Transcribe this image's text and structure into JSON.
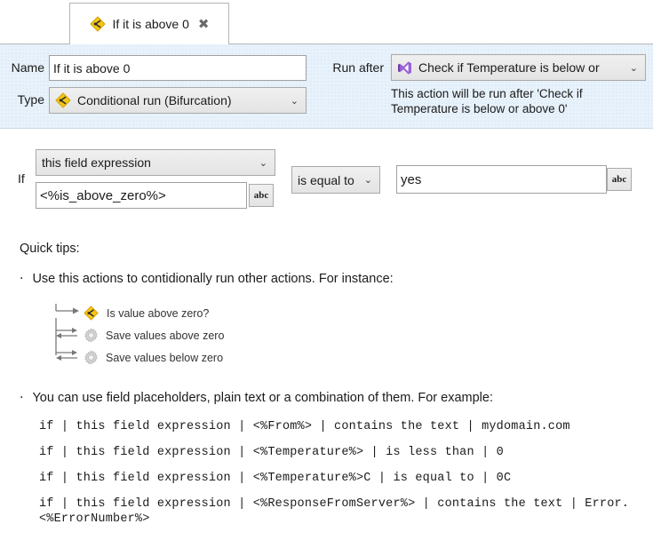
{
  "tab": {
    "label": "If it is above 0",
    "icon": "bifurcation-diamond-icon",
    "close_glyph": "✖"
  },
  "header": {
    "name_label": "Name",
    "name_value": "If it is above 0",
    "type_label": "Type",
    "type_value": "Conditional run (Bifurcation)",
    "type_icon": "bifurcation-diamond-icon",
    "run_after_label": "Run after",
    "run_after_value": "Check if Temperature is below or",
    "run_after_icon": "visual-studio-icon",
    "run_after_help": "This action will be run after 'Check if Temperature is below or above 0'",
    "chevron": "⌄",
    "panel_bg": "#e8f2fb"
  },
  "condition": {
    "if_label": "If",
    "field_selector": "this field expression",
    "expression_value": "<%is_above_zero%>",
    "expression_abc_label": "abc",
    "operator": "is equal to",
    "value": "yes",
    "value_abc_label": "abc",
    "chevron": "⌄"
  },
  "quick_tips": {
    "title": "Quick tips:",
    "bullet_glyph": "·",
    "tip1": "Use this actions to contidionally run other actions. For instance:",
    "tip2": "You can use field placeholders, plain text or a combination of them. For example:",
    "tree": [
      {
        "label": "Is value above zero?",
        "icon": "bifurcation-diamond-icon"
      },
      {
        "label": "Save values above zero",
        "icon": "gear-icon"
      },
      {
        "label": "Save values below zero",
        "icon": "gear-icon"
      }
    ],
    "examples": [
      "if | this field expression | <%From%> | contains the text | mydomain.com",
      "if | this field expression | <%Temperature%> | is less than | 0",
      "if | this field expression | <%Temperature%>C | is equal to | 0C",
      "if | this field expression | <%ResponseFromServer%> | contains the text | Error. <%ErrorNumber%>"
    ]
  },
  "colors": {
    "diamond_fill": "#f5c518",
    "vs_purple": "#8e5ecb",
    "gear_gray": "#cfcfcf"
  }
}
